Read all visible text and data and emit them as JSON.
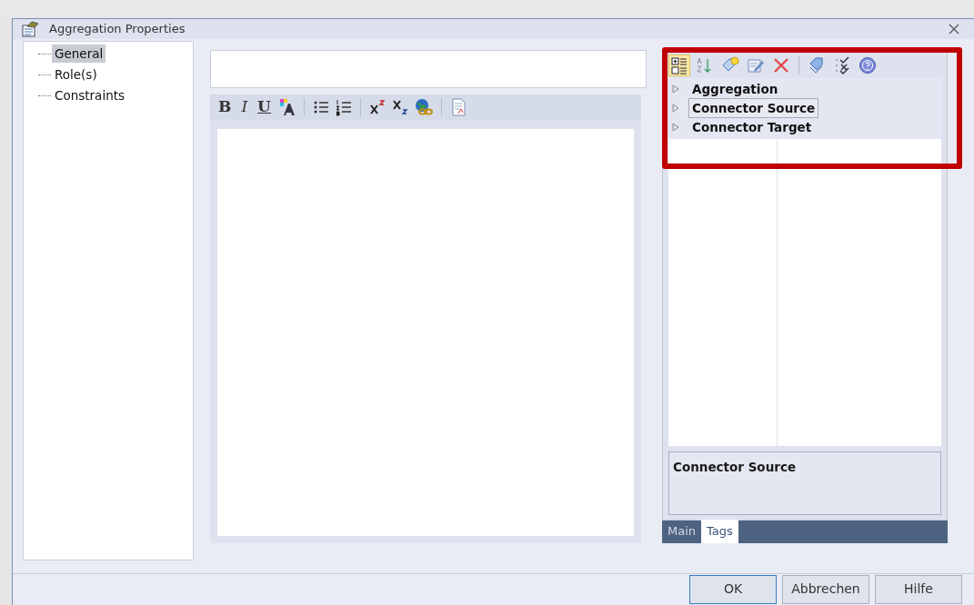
{
  "window": {
    "title": "Aggregation Properties"
  },
  "nav_tree": [
    {
      "label": "General",
      "selected": true
    },
    {
      "label": "Role(s)",
      "selected": false
    },
    {
      "label": "Constraints",
      "selected": false
    }
  ],
  "format_buttons": [
    "B",
    "I",
    "U"
  ],
  "property_toolbar": {
    "categorized": true
  },
  "property_groups": [
    {
      "label": "Aggregation",
      "selected": false,
      "expanded": false
    },
    {
      "label": "Connector Source",
      "selected": true,
      "expanded": false
    },
    {
      "label": "Connector Target",
      "selected": false,
      "expanded": false
    }
  ],
  "description": {
    "title": "Connector Source"
  },
  "tabs": [
    {
      "label": "Main",
      "selected": false
    },
    {
      "label": "Tags",
      "selected": true
    }
  ],
  "buttons": [
    {
      "label": "OK",
      "default": true
    },
    {
      "label": "Abbrechen",
      "default": false
    },
    {
      "label": "Hilfe",
      "default": false
    }
  ],
  "annotation": {
    "highlight": true
  }
}
